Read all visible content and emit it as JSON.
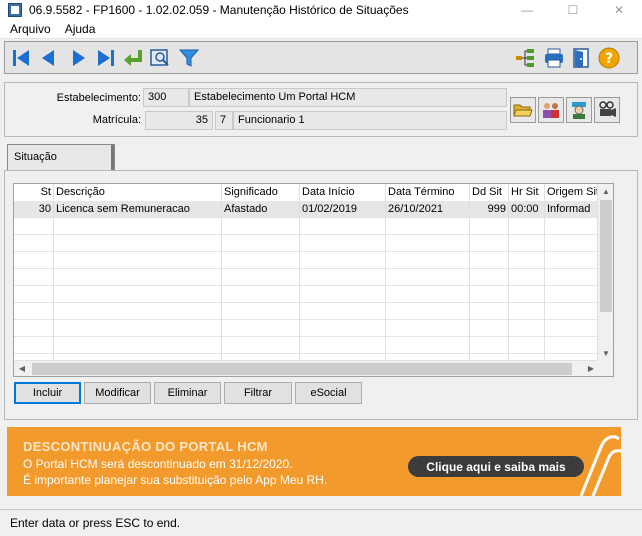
{
  "window": {
    "title": "06.9.5582 - FP1600 - 1.02.02.059 - Manutenção Histórico de Situações",
    "controls": [
      "—",
      "☐",
      "✕"
    ]
  },
  "menu": {
    "items": [
      "Arquivo",
      "Ajuda"
    ]
  },
  "toolbar": {
    "buttons": [
      "first-record",
      "previous-record",
      "next-record",
      "last-record",
      "go-to",
      "search",
      "filter",
      "structure",
      "print",
      "exit",
      "help"
    ]
  },
  "form": {
    "estabelecimento_label": "Estabelecimento:",
    "estabelecimento_code": "300",
    "estabelecimento_name": "Estabelecimento Um Portal HCM",
    "matricula_label": "Matrícula:",
    "matricula_num": "35",
    "matricula_digit": "7",
    "matricula_name": "Funcionario 1"
  },
  "tab": {
    "label": "Situação"
  },
  "grid": {
    "headers": [
      "St",
      "Descrição",
      "Significado",
      "Data Início",
      "Data Término",
      "Dd Sit",
      "Hr Sit",
      "Origem Situ"
    ],
    "rows": [
      [
        "30",
        "Licenca sem Remuneracao",
        "Afastado",
        "01/02/2019",
        "26/10/2021",
        "999",
        "00:00",
        "Informad"
      ]
    ]
  },
  "actions": {
    "incluir": "Incluir",
    "modificar": "Modificar",
    "eliminar": "Eliminar",
    "filtrar": "Filtrar",
    "esocial": "eSocial"
  },
  "banner": {
    "title": "DESCONTINUAÇÃO DO PORTAL HCM",
    "line1": "O Portal HCM será descontinuado em 31/12/2020.",
    "line2": "É importante planejar sua substituição pelo App Meu RH.",
    "cta": "Clique aqui e saiba mais"
  },
  "status": {
    "text": "Enter data or press ESC to end."
  },
  "colors": {
    "banner": "#f29a2c",
    "nav_blue": "#1b6fd1",
    "cta_bg": "#3c3c3c"
  }
}
